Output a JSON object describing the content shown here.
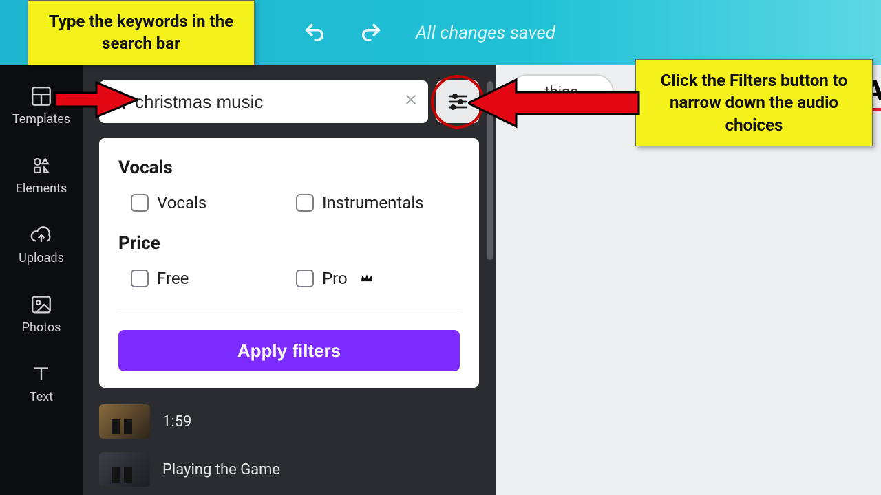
{
  "topbar": {
    "status_text": "All changes saved"
  },
  "rail": {
    "templates": "Templates",
    "elements": "Elements",
    "uploads": "Uploads",
    "photos": "Photos",
    "text": "Text"
  },
  "search": {
    "value": "christmas music"
  },
  "filters": {
    "vocals_heading": "Vocals",
    "vocals_option": "Vocals",
    "instrumentals_option": "Instrumentals",
    "price_heading": "Price",
    "free_option": "Free",
    "pro_option": "Pro",
    "apply_label": "Apply filters"
  },
  "tracks": {
    "duration1": "1:59",
    "title2": "Playing the Game"
  },
  "canvas": {
    "pill_text": "thing",
    "corner_letter": "A"
  },
  "callouts": {
    "left": "Type the keywords in the search bar",
    "right": "Click the Filters button to narrow down the audio choices"
  }
}
